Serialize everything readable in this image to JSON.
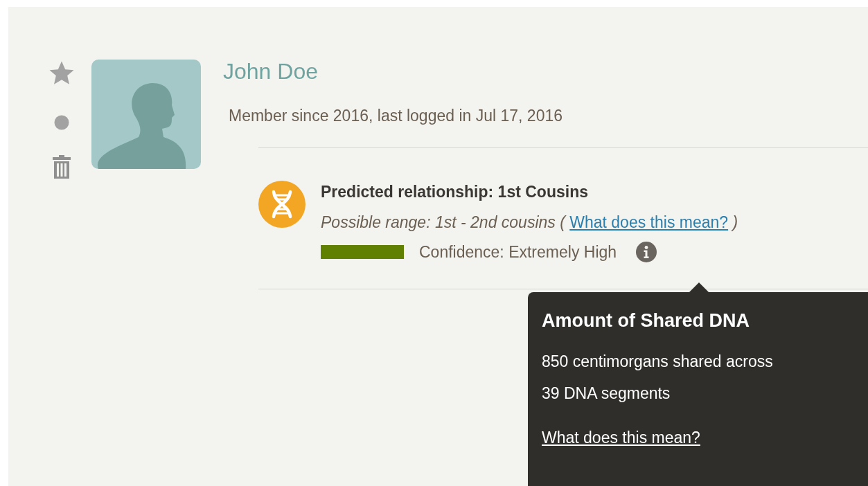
{
  "member": {
    "name": "John Doe",
    "since": "Member since 2016, last logged in Jul 17, 2016"
  },
  "relationship": {
    "title": "Predicted relationship: 1st Cousins",
    "range": "Possible range: 1st - 2nd cousins (",
    "range_link": "What does this mean?",
    "range_close": ")",
    "confidence": "Confidence: Extremely High"
  },
  "tooltip": {
    "title": "Amount of Shared DNA",
    "body": "850 centimorgans shared across 39 DNA segments",
    "link": "What does this mean?"
  }
}
